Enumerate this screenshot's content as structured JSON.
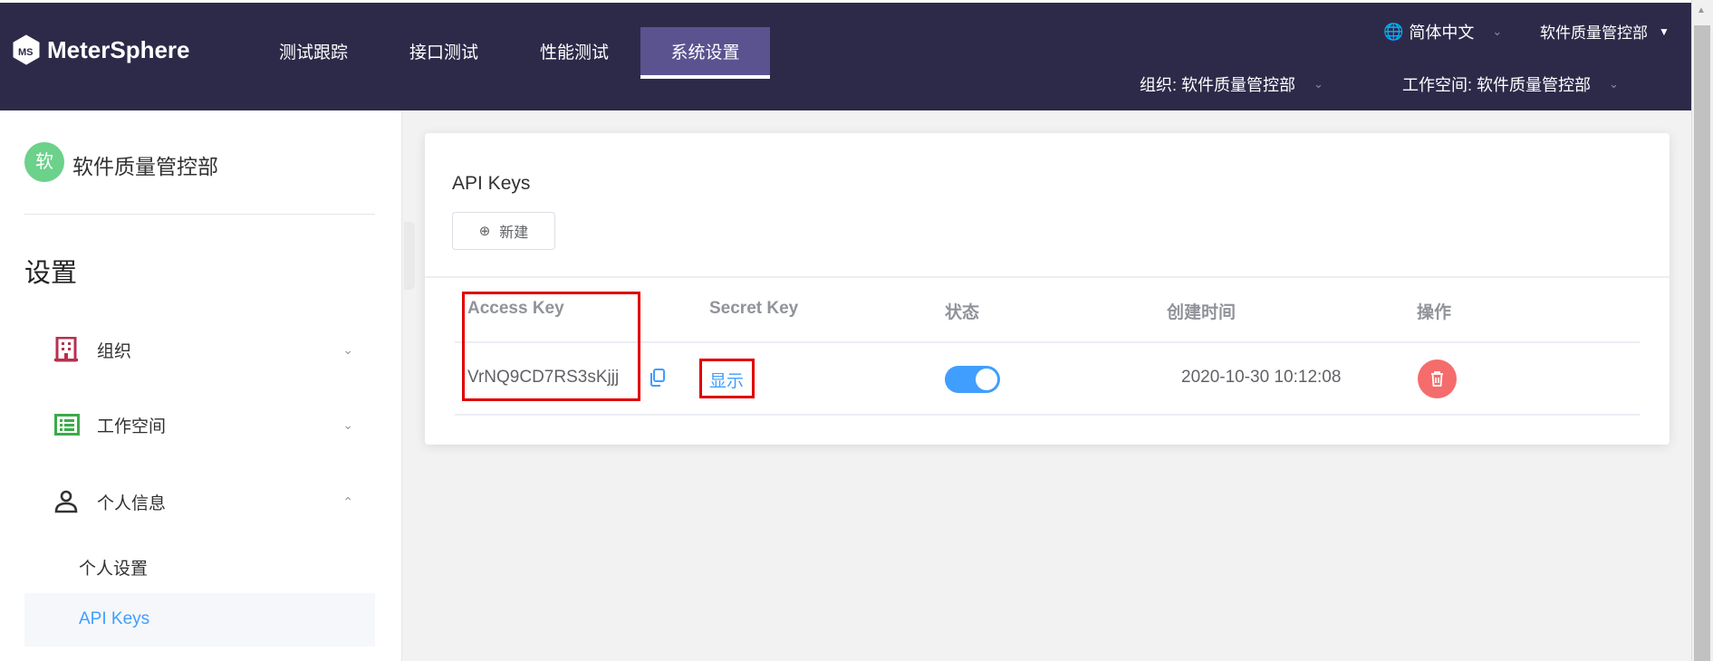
{
  "header": {
    "brand": "MeterSphere",
    "nav": [
      "测试跟踪",
      "接口测试",
      "性能测试",
      "系统设置"
    ],
    "active_nav": "系统设置",
    "language": "简体中文",
    "user": "软件质量管控部",
    "organization": "组织: 软件质量管控部",
    "workspace": "工作空间: 软件质量管控部"
  },
  "sidebar": {
    "avatar": "软",
    "org_name": "软件质量管控部",
    "section_title": "设置",
    "menus": [
      {
        "label": "组织"
      },
      {
        "label": "工作空间"
      },
      {
        "label": "个人信息"
      }
    ],
    "sub_items": [
      "个人设置",
      "API Keys"
    ],
    "active_sub": "API Keys"
  },
  "main": {
    "title": "API Keys",
    "new_button": "新建",
    "columns": [
      "Access Key",
      "Secret Key",
      "状态",
      "创建时间",
      "操作"
    ],
    "rows": [
      {
        "access_key": "VrNQ9CD7RS3sKjjj",
        "secret_key_action": "显示",
        "enabled": true,
        "created": "2020-10-30 10:12:08"
      }
    ]
  },
  "colors": {
    "header": "#2d2a49",
    "active_tab": "#5a5390",
    "primary": "#409eff",
    "danger": "#f56c6c",
    "highlight": "#e00000"
  }
}
